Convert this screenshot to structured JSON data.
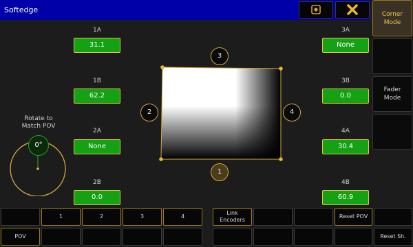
{
  "window": {
    "title": "Softedge"
  },
  "side_panel": [
    {
      "label": "Corner\nMode",
      "active": true
    },
    {
      "label": "",
      "active": false
    },
    {
      "label": "Fader\nMode",
      "active": false
    },
    {
      "label": "",
      "active": false
    }
  ],
  "fields": {
    "f1A": {
      "label": "1A",
      "value": "31.1"
    },
    "f1B": {
      "label": "1B",
      "value": "62.2"
    },
    "f2A": {
      "label": "2A",
      "value": "None"
    },
    "f2B": {
      "label": "2B",
      "value": "0.0"
    },
    "f3A": {
      "label": "3A",
      "value": "None"
    },
    "f3B": {
      "label": "3B",
      "value": "0.0"
    },
    "f4A": {
      "label": "4A",
      "value": "30.4"
    },
    "f4B": {
      "label": "4B",
      "value": "60.9"
    }
  },
  "sides": {
    "s1": "1",
    "s2": "2",
    "s3": "3",
    "s4": "4"
  },
  "rotate": {
    "label_line1": "Rotate to",
    "label_line2": "Match POV",
    "value": "0°"
  },
  "bottom_row1": [
    "",
    "1",
    "2",
    "3",
    "4",
    "Link\nEncoders",
    "",
    "",
    "Reset POV",
    ""
  ],
  "bottom_row2": [
    "POV",
    "",
    "",
    "",
    "",
    "",
    "",
    "",
    "",
    "Reset Sh."
  ],
  "colors": {
    "accent": "#e5c34b",
    "field_green": "#14a114",
    "title_blue": "#0000a8"
  }
}
